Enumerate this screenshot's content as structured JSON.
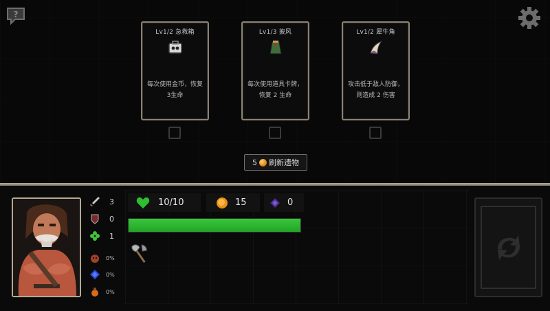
{
  "relics": [
    {
      "title": "Lv1/2 急救箱",
      "icon": "first-aid-kit-icon",
      "description": [
        "每次使用金币，恢复",
        "3生命"
      ]
    },
    {
      "title": "Lv1/3 披风",
      "icon": "cloak-icon",
      "description": [
        "每次使用道具卡牌，",
        "恢复 2 生命"
      ]
    },
    {
      "title": "Lv1/2 犀牛角",
      "icon": "rhino-horn-icon",
      "description": [
        "攻击低于敌人防御，",
        "则造成 2 伤害"
      ]
    }
  ],
  "refresh": {
    "cost": "5",
    "label": "刷新遗物",
    "icon": "gold-coin-icon"
  },
  "top_icons": {
    "help": "help-bubble-icon",
    "settings": "gear-icon"
  },
  "stats": {
    "attack": "3",
    "defense": "0",
    "luck": "1",
    "pct1": "0%",
    "pct2": "0%",
    "pct3": "0%"
  },
  "resources": {
    "hp_text": "10/10",
    "gold": "15",
    "gems": "0",
    "hp_fraction": 1.0
  },
  "colors": {
    "hp_green": "#2fbe32",
    "gold": "#f0a020",
    "gem": "#5a3a9a",
    "frame": "#b5aa92"
  }
}
